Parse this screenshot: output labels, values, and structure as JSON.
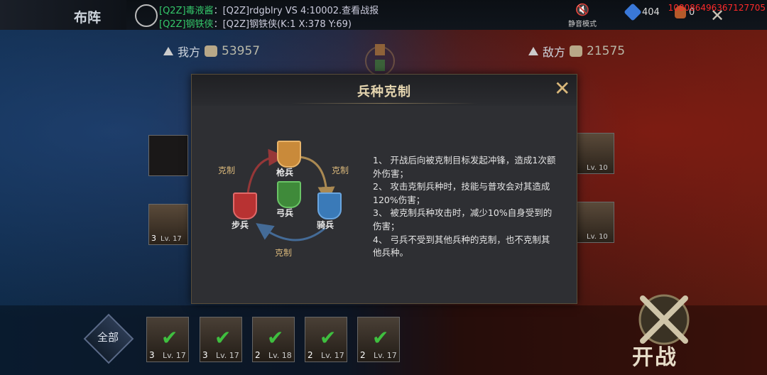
{
  "header": {
    "title": "布阵",
    "chat": [
      {
        "tag": "[Q2Z]毒液酱",
        "text": "：[Q2Z]rdgblry VS 4:10002.查看战报"
      },
      {
        "tag": "[Q2Z]钢铁侠",
        "text": "：[Q2Z]钢铁侠(K:1 X:378 Y:69)"
      }
    ],
    "mute_label": "静音模式",
    "gems": "404",
    "resource": "0",
    "uid": "108086496367127705"
  },
  "sides": {
    "mine_label": "我方",
    "mine_power": "53957",
    "enemy_label": "敌方",
    "enemy_power": "21575"
  },
  "left_heroes": [
    {
      "num": "3",
      "lv": "Lv. 17"
    }
  ],
  "right_heroes": [
    {
      "lv": "Lv. 10"
    },
    {
      "lv": "Lv. 10"
    }
  ],
  "bottom": {
    "all_label": "全部",
    "cards": [
      {
        "num": "3",
        "lv": "Lv. 17"
      },
      {
        "num": "3",
        "lv": "Lv. 17"
      },
      {
        "num": "2",
        "lv": "Lv. 18"
      },
      {
        "num": "2",
        "lv": "Lv. 17"
      },
      {
        "num": "2",
        "lv": "Lv. 17"
      }
    ],
    "fight_label": "开战"
  },
  "modal": {
    "title": "兵种克制",
    "units": {
      "spear": "枪兵",
      "archer": "弓兵",
      "cavalry": "骑兵",
      "infantry": "步兵"
    },
    "counter_label": "克制",
    "rules": [
      "1、 开战后向被克制目标发起冲锋，造成1次额外伤害；",
      "2、 攻击克制兵种时，技能与普攻会对其造成120%伤害；",
      "3、 被克制兵种攻击时，减少10%自身受到的伤害；",
      "4、 弓兵不受到其他兵种的克制，也不克制其他兵种。"
    ]
  },
  "colors": {
    "modal_bg": "#2e2f33",
    "accent_gold": "#d9b77a",
    "spear": "#c98a3a",
    "archer": "#3f8a3a",
    "cavalry": "#3a7ab8",
    "infantry": "#b83232"
  }
}
